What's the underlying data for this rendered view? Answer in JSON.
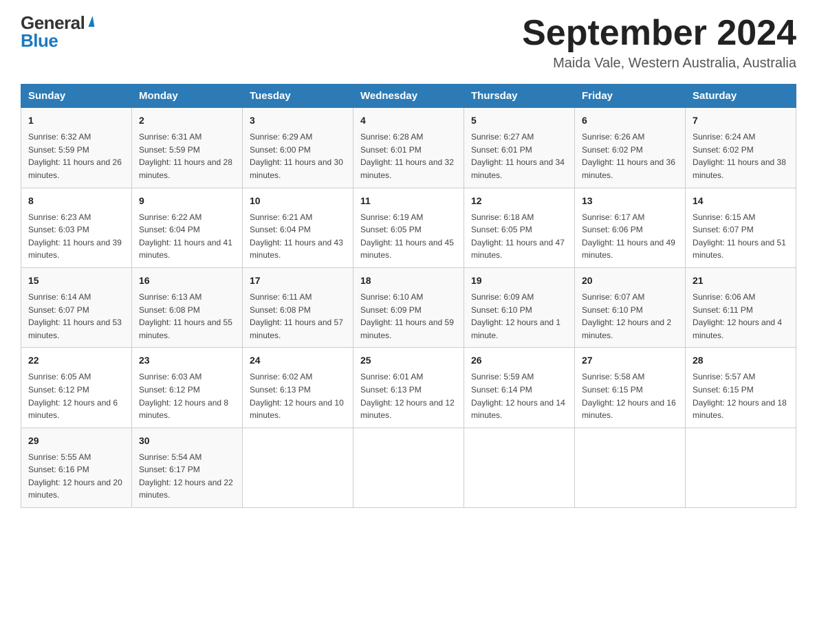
{
  "header": {
    "logo_general": "General",
    "logo_blue": "Blue",
    "month_title": "September 2024",
    "location": "Maida Vale, Western Australia, Australia"
  },
  "calendar": {
    "days_of_week": [
      "Sunday",
      "Monday",
      "Tuesday",
      "Wednesday",
      "Thursday",
      "Friday",
      "Saturday"
    ],
    "weeks": [
      [
        {
          "day": "1",
          "sunrise": "6:32 AM",
          "sunset": "5:59 PM",
          "daylight": "11 hours and 26 minutes."
        },
        {
          "day": "2",
          "sunrise": "6:31 AM",
          "sunset": "5:59 PM",
          "daylight": "11 hours and 28 minutes."
        },
        {
          "day": "3",
          "sunrise": "6:29 AM",
          "sunset": "6:00 PM",
          "daylight": "11 hours and 30 minutes."
        },
        {
          "day": "4",
          "sunrise": "6:28 AM",
          "sunset": "6:01 PM",
          "daylight": "11 hours and 32 minutes."
        },
        {
          "day": "5",
          "sunrise": "6:27 AM",
          "sunset": "6:01 PM",
          "daylight": "11 hours and 34 minutes."
        },
        {
          "day": "6",
          "sunrise": "6:26 AM",
          "sunset": "6:02 PM",
          "daylight": "11 hours and 36 minutes."
        },
        {
          "day": "7",
          "sunrise": "6:24 AM",
          "sunset": "6:02 PM",
          "daylight": "11 hours and 38 minutes."
        }
      ],
      [
        {
          "day": "8",
          "sunrise": "6:23 AM",
          "sunset": "6:03 PM",
          "daylight": "11 hours and 39 minutes."
        },
        {
          "day": "9",
          "sunrise": "6:22 AM",
          "sunset": "6:04 PM",
          "daylight": "11 hours and 41 minutes."
        },
        {
          "day": "10",
          "sunrise": "6:21 AM",
          "sunset": "6:04 PM",
          "daylight": "11 hours and 43 minutes."
        },
        {
          "day": "11",
          "sunrise": "6:19 AM",
          "sunset": "6:05 PM",
          "daylight": "11 hours and 45 minutes."
        },
        {
          "day": "12",
          "sunrise": "6:18 AM",
          "sunset": "6:05 PM",
          "daylight": "11 hours and 47 minutes."
        },
        {
          "day": "13",
          "sunrise": "6:17 AM",
          "sunset": "6:06 PM",
          "daylight": "11 hours and 49 minutes."
        },
        {
          "day": "14",
          "sunrise": "6:15 AM",
          "sunset": "6:07 PM",
          "daylight": "11 hours and 51 minutes."
        }
      ],
      [
        {
          "day": "15",
          "sunrise": "6:14 AM",
          "sunset": "6:07 PM",
          "daylight": "11 hours and 53 minutes."
        },
        {
          "day": "16",
          "sunrise": "6:13 AM",
          "sunset": "6:08 PM",
          "daylight": "11 hours and 55 minutes."
        },
        {
          "day": "17",
          "sunrise": "6:11 AM",
          "sunset": "6:08 PM",
          "daylight": "11 hours and 57 minutes."
        },
        {
          "day": "18",
          "sunrise": "6:10 AM",
          "sunset": "6:09 PM",
          "daylight": "11 hours and 59 minutes."
        },
        {
          "day": "19",
          "sunrise": "6:09 AM",
          "sunset": "6:10 PM",
          "daylight": "12 hours and 1 minute."
        },
        {
          "day": "20",
          "sunrise": "6:07 AM",
          "sunset": "6:10 PM",
          "daylight": "12 hours and 2 minutes."
        },
        {
          "day": "21",
          "sunrise": "6:06 AM",
          "sunset": "6:11 PM",
          "daylight": "12 hours and 4 minutes."
        }
      ],
      [
        {
          "day": "22",
          "sunrise": "6:05 AM",
          "sunset": "6:12 PM",
          "daylight": "12 hours and 6 minutes."
        },
        {
          "day": "23",
          "sunrise": "6:03 AM",
          "sunset": "6:12 PM",
          "daylight": "12 hours and 8 minutes."
        },
        {
          "day": "24",
          "sunrise": "6:02 AM",
          "sunset": "6:13 PM",
          "daylight": "12 hours and 10 minutes."
        },
        {
          "day": "25",
          "sunrise": "6:01 AM",
          "sunset": "6:13 PM",
          "daylight": "12 hours and 12 minutes."
        },
        {
          "day": "26",
          "sunrise": "5:59 AM",
          "sunset": "6:14 PM",
          "daylight": "12 hours and 14 minutes."
        },
        {
          "day": "27",
          "sunrise": "5:58 AM",
          "sunset": "6:15 PM",
          "daylight": "12 hours and 16 minutes."
        },
        {
          "day": "28",
          "sunrise": "5:57 AM",
          "sunset": "6:15 PM",
          "daylight": "12 hours and 18 minutes."
        }
      ],
      [
        {
          "day": "29",
          "sunrise": "5:55 AM",
          "sunset": "6:16 PM",
          "daylight": "12 hours and 20 minutes."
        },
        {
          "day": "30",
          "sunrise": "5:54 AM",
          "sunset": "6:17 PM",
          "daylight": "12 hours and 22 minutes."
        },
        null,
        null,
        null,
        null,
        null
      ]
    ]
  }
}
